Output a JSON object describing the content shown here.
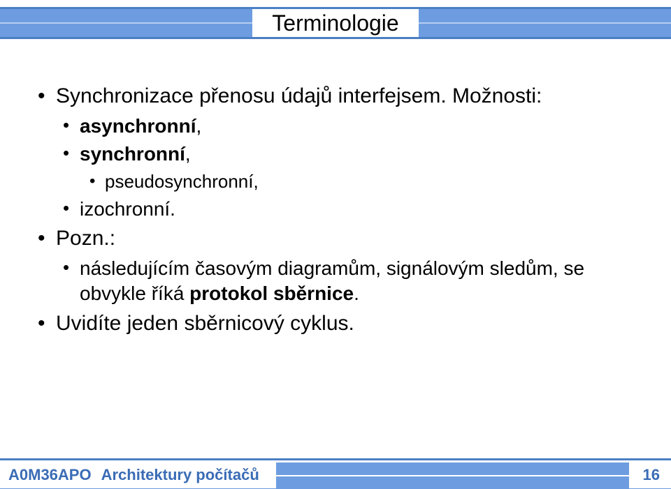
{
  "header": {
    "title": "Terminologie"
  },
  "content": {
    "items": [
      {
        "level": 1,
        "text": "Synchronizace přenosu údajů interfejsem. Možnosti:"
      },
      {
        "level": 2,
        "html": "<span class=\"bold\">asynchronní</span>,"
      },
      {
        "level": 2,
        "html": "<span class=\"bold\">synchronní</span>,"
      },
      {
        "level": 3,
        "text": "pseudosynchronní,"
      },
      {
        "level": 2,
        "text": "izochronní."
      },
      {
        "level": 1,
        "text": "Pozn.:"
      },
      {
        "level": 2,
        "html": "následujícím časovým diagramům, signálovým sledům, se obvykle říká <span class=\"bold\">protokol sběrnice</span>."
      },
      {
        "level": 1,
        "text": "Uvidíte jeden sběrnicový cyklus."
      }
    ]
  },
  "footer": {
    "code": "A0M36APO",
    "title": "Architektury počítačů",
    "page": "16"
  }
}
